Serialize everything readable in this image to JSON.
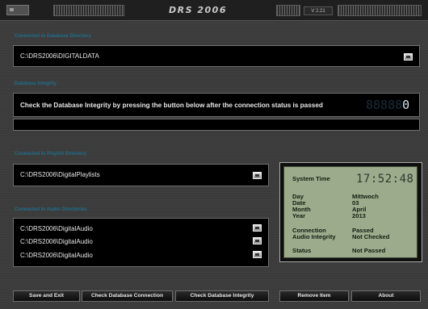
{
  "app": {
    "title": "DRS 2006",
    "version": "V 2.21"
  },
  "database_directory": {
    "label": "Connected to Database Directory",
    "path": "C:\\DRS2006\\DIGITALDATA"
  },
  "integrity": {
    "label": "Database Integrity",
    "message": "Check the Database Integrity by pressing the button below after the connection status is passed",
    "counter_dim": "88888",
    "counter_lit": "0",
    "result": ""
  },
  "playlist_directory": {
    "label": "Connected to Playlist Directory",
    "path": "C:\\DRS2006\\DigitalPlaylists"
  },
  "audio_directories": {
    "label": "Connected to Audio Directories",
    "paths": [
      "C:\\DRS2006\\DigitalAudio",
      "C:\\DRS2006\\DigitalAudio",
      "C:\\DRS2006\\DigitalAudio"
    ]
  },
  "status_panel": {
    "system_time_label": "System Time",
    "system_time": "17:52:48",
    "rows": [
      {
        "label": "Day",
        "value": "Mittwoch"
      },
      {
        "label": "Date",
        "value": "03"
      },
      {
        "label": "Month",
        "value": "April"
      },
      {
        "label": "Year",
        "value": "2013"
      },
      {
        "label": "Connection",
        "value": "Passed"
      },
      {
        "label": "Audio Integrity",
        "value": "Not Checked"
      },
      {
        "label": "Status",
        "value": "Not Passed"
      }
    ],
    "colors": {
      "lcd_background": "#9dab8d",
      "lcd_text": "#0f1e10"
    }
  },
  "buttons": {
    "save_exit": "Save and Exit",
    "check_connection": "Check Database Connection",
    "check_integrity": "Check Database Integrity",
    "remove_item": "Remove Item",
    "about": "About"
  },
  "colors": {
    "section_label": "#1f6e8a",
    "field_background": "#000000",
    "window_background": "#3b3b3b"
  },
  "icons": {
    "menu": "system-menu-icon",
    "browse": "folder-browse-icon"
  }
}
